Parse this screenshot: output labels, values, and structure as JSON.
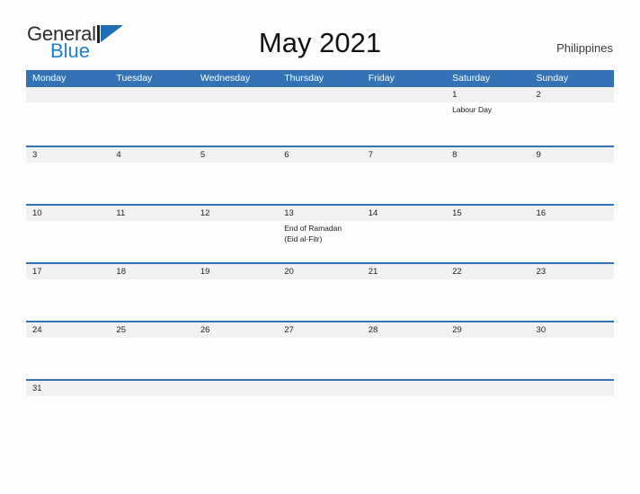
{
  "brand": {
    "name_part1": "General",
    "name_part2": "Blue",
    "flag_icon": "flag-triangle-icon"
  },
  "header": {
    "title": "May 2021",
    "country": "Philippines"
  },
  "colors": {
    "header_blue": "#3372b5",
    "row_divider_blue": "#3372b5",
    "number_band_gray": "#f1f1f1",
    "brand_blue": "#1f7fd1",
    "page_background": "#fdfdfd"
  },
  "calendar": {
    "weekdays": [
      "Monday",
      "Tuesday",
      "Wednesday",
      "Thursday",
      "Friday",
      "Saturday",
      "Sunday"
    ],
    "weeks": [
      {
        "days": [
          {
            "number": "",
            "event": ""
          },
          {
            "number": "",
            "event": ""
          },
          {
            "number": "",
            "event": ""
          },
          {
            "number": "",
            "event": ""
          },
          {
            "number": "",
            "event": ""
          },
          {
            "number": "1",
            "event": "Labour Day"
          },
          {
            "number": "2",
            "event": ""
          }
        ]
      },
      {
        "days": [
          {
            "number": "3",
            "event": ""
          },
          {
            "number": "4",
            "event": ""
          },
          {
            "number": "5",
            "event": ""
          },
          {
            "number": "6",
            "event": ""
          },
          {
            "number": "7",
            "event": ""
          },
          {
            "number": "8",
            "event": ""
          },
          {
            "number": "9",
            "event": ""
          }
        ]
      },
      {
        "days": [
          {
            "number": "10",
            "event": ""
          },
          {
            "number": "11",
            "event": ""
          },
          {
            "number": "12",
            "event": ""
          },
          {
            "number": "13",
            "event": "End of Ramadan\n(Eid al-Fitr)"
          },
          {
            "number": "14",
            "event": ""
          },
          {
            "number": "15",
            "event": ""
          },
          {
            "number": "16",
            "event": ""
          }
        ]
      },
      {
        "days": [
          {
            "number": "17",
            "event": ""
          },
          {
            "number": "18",
            "event": ""
          },
          {
            "number": "19",
            "event": ""
          },
          {
            "number": "20",
            "event": ""
          },
          {
            "number": "21",
            "event": ""
          },
          {
            "number": "22",
            "event": ""
          },
          {
            "number": "23",
            "event": ""
          }
        ]
      },
      {
        "days": [
          {
            "number": "24",
            "event": ""
          },
          {
            "number": "25",
            "event": ""
          },
          {
            "number": "26",
            "event": ""
          },
          {
            "number": "27",
            "event": ""
          },
          {
            "number": "28",
            "event": ""
          },
          {
            "number": "29",
            "event": ""
          },
          {
            "number": "30",
            "event": ""
          }
        ]
      },
      {
        "days": [
          {
            "number": "31",
            "event": ""
          },
          {
            "number": "",
            "event": ""
          },
          {
            "number": "",
            "event": ""
          },
          {
            "number": "",
            "event": ""
          },
          {
            "number": "",
            "event": ""
          },
          {
            "number": "",
            "event": ""
          },
          {
            "number": "",
            "event": ""
          }
        ]
      }
    ]
  }
}
